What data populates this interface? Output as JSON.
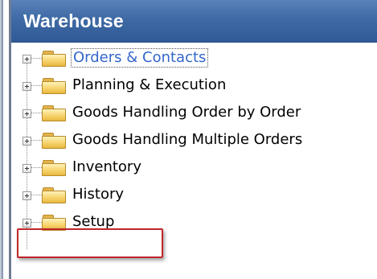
{
  "header": {
    "title": "Warehouse"
  },
  "tree": {
    "items": [
      {
        "label": "Orders & Contacts",
        "selected": true,
        "icon": "folder-icon"
      },
      {
        "label": "Planning & Execution",
        "selected": false,
        "icon": "folder-icon"
      },
      {
        "label": "Goods Handling Order by Order",
        "selected": false,
        "icon": "folder-icon"
      },
      {
        "label": "Goods Handling Multiple Orders",
        "selected": false,
        "icon": "folder-icon"
      },
      {
        "label": "Inventory",
        "selected": false,
        "icon": "folder-icon"
      },
      {
        "label": "History",
        "selected": false,
        "icon": "folder-icon"
      },
      {
        "label": "Setup",
        "selected": false,
        "icon": "folder-icon",
        "highlighted": true
      }
    ]
  },
  "colors": {
    "header_bg": "#3f6aa5",
    "selected_text": "#3366cc",
    "highlight_border": "#c0262a",
    "folder": "#f7d46e"
  }
}
